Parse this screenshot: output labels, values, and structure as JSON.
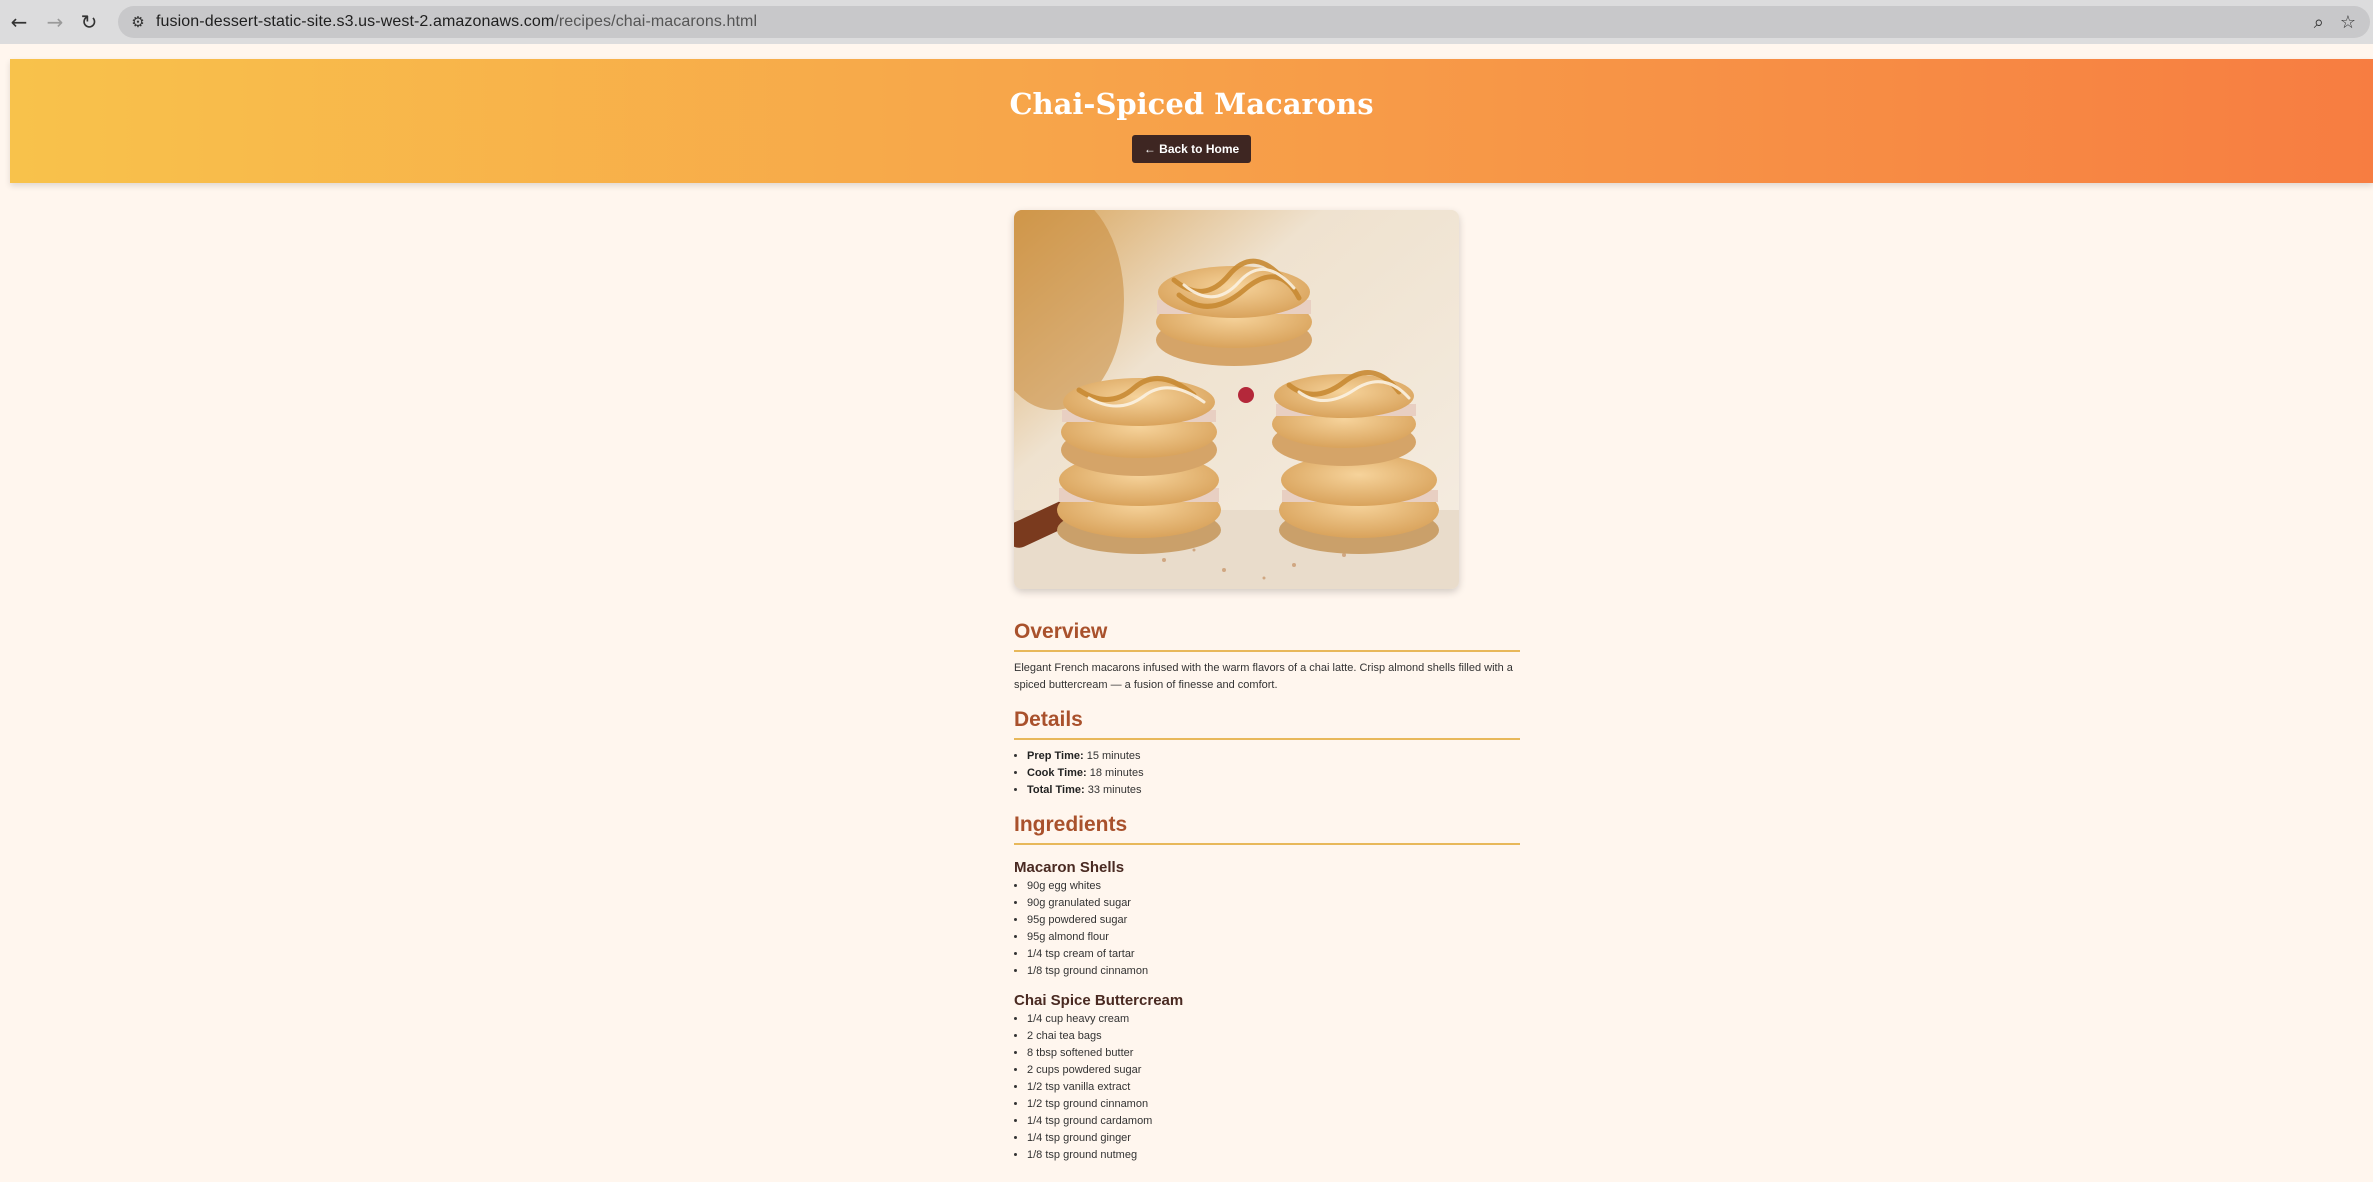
{
  "browser": {
    "url_domain": "fusion-dessert-static-site.s3.us-west-2.amazonaws.com",
    "url_path": "/recipes/chai-macarons.html",
    "icons": [
      "back-arrow-icon",
      "forward-arrow-icon",
      "reload-icon",
      "site-info-icon",
      "zoom-icon",
      "bookmark-star-icon"
    ]
  },
  "header": {
    "title": "Chai-Spiced Macarons",
    "back_label": "← Back to Home"
  },
  "overview": {
    "heading": "Overview",
    "text": "Elegant French macarons infused with the warm flavors of a chai latte. Crisp almond shells filled with a spiced buttercream — a fusion of finesse and comfort."
  },
  "details": {
    "heading": "Details",
    "items": [
      {
        "label": "Prep Time:",
        "value": "15 minutes"
      },
      {
        "label": "Cook Time:",
        "value": "18 minutes"
      },
      {
        "label": "Total Time:",
        "value": "33 minutes"
      }
    ]
  },
  "ingredients": {
    "heading": "Ingredients",
    "groups": [
      {
        "title": "Macaron Shells",
        "items": [
          "90g egg whites",
          "90g granulated sugar",
          "95g powdered sugar",
          "95g almond flour",
          "1/4 tsp cream of tartar",
          "1/8 tsp ground cinnamon"
        ]
      },
      {
        "title": "Chai Spice Buttercream",
        "items": [
          "1/4 cup heavy cream",
          "2 chai tea bags",
          "8 tbsp softened butter",
          "2 cups powdered sugar",
          "1/2 tsp vanilla extract",
          "1/2 tsp ground cinnamon",
          "1/4 tsp ground cardamom",
          "1/4 tsp ground ginger",
          "1/8 tsp ground nutmeg"
        ]
      }
    ]
  },
  "colors": {
    "gradient_start": "#f8c24b",
    "gradient_end": "#f77d41",
    "heading": "#a9512c",
    "rule": "#e8b85a",
    "button_bg": "#3e2622",
    "page_bg": "#fff6ee"
  }
}
